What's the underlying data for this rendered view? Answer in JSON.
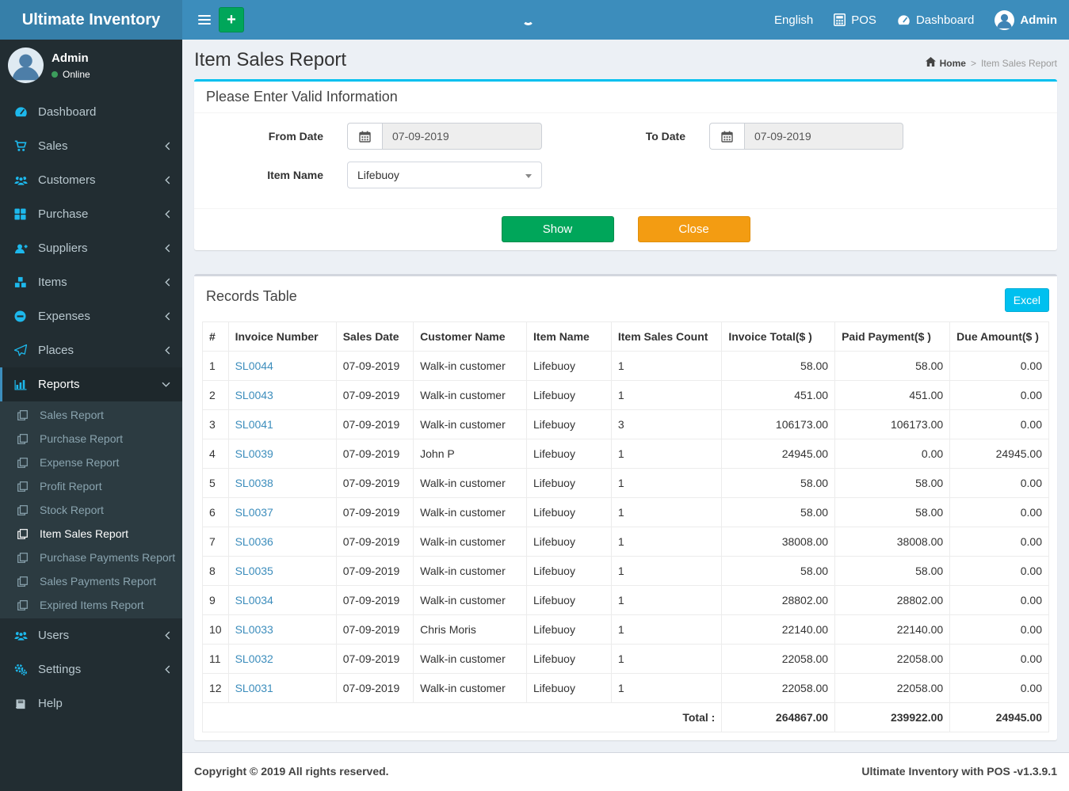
{
  "app": {
    "title": "Ultimate Inventory",
    "version_note": "Ultimate Inventory with POS -v1.3.9.1",
    "copyright": "Copyright © 2019 All rights reserved."
  },
  "navbar": {
    "language": "English",
    "pos": "POS",
    "dashboard": "Dashboard",
    "user": "Admin"
  },
  "sidebar": {
    "user": {
      "name": "Admin",
      "status": "Online"
    },
    "items": [
      {
        "label": "Dashboard"
      },
      {
        "label": "Sales"
      },
      {
        "label": "Customers"
      },
      {
        "label": "Purchase"
      },
      {
        "label": "Suppliers"
      },
      {
        "label": "Items"
      },
      {
        "label": "Expenses"
      },
      {
        "label": "Places"
      },
      {
        "label": "Reports"
      },
      {
        "label": "Users"
      },
      {
        "label": "Settings"
      },
      {
        "label": "Help"
      }
    ],
    "reports_submenu": [
      "Sales Report",
      "Purchase Report",
      "Expense Report",
      "Profit Report",
      "Stock Report",
      "Item Sales Report",
      "Purchase Payments Report",
      "Sales Payments Report",
      "Expired Items Report"
    ],
    "active_item": "Reports",
    "active_submenu": "Item Sales Report"
  },
  "page": {
    "title": "Item Sales Report",
    "breadcrumb": {
      "home": "Home",
      "current": "Item Sales Report"
    }
  },
  "filter_box": {
    "title": "Please Enter Valid Information",
    "from_date_label": "From Date",
    "from_date_value": "07-09-2019",
    "to_date_label": "To Date",
    "to_date_value": "07-09-2019",
    "item_name_label": "Item Name",
    "item_name_value": "Lifebuoy",
    "show_button": "Show",
    "close_button": "Close"
  },
  "records": {
    "title": "Records Table",
    "excel_button": "Excel",
    "columns": [
      "#",
      "Invoice Number",
      "Sales Date",
      "Customer Name",
      "Item Name",
      "Item Sales Count",
      "Invoice Total($ )",
      "Paid Payment($ )",
      "Due Amount($ )"
    ],
    "rows": [
      {
        "num": "1",
        "invoice": "SL0044",
        "date": "07-09-2019",
        "customer": "Walk-in customer",
        "item": "Lifebuoy",
        "count": "1",
        "total": "58.00",
        "paid": "58.00",
        "due": "0.00"
      },
      {
        "num": "2",
        "invoice": "SL0043",
        "date": "07-09-2019",
        "customer": "Walk-in customer",
        "item": "Lifebuoy",
        "count": "1",
        "total": "451.00",
        "paid": "451.00",
        "due": "0.00"
      },
      {
        "num": "3",
        "invoice": "SL0041",
        "date": "07-09-2019",
        "customer": "Walk-in customer",
        "item": "Lifebuoy",
        "count": "3",
        "total": "106173.00",
        "paid": "106173.00",
        "due": "0.00"
      },
      {
        "num": "4",
        "invoice": "SL0039",
        "date": "07-09-2019",
        "customer": "John P",
        "item": "Lifebuoy",
        "count": "1",
        "total": "24945.00",
        "paid": "0.00",
        "due": "24945.00"
      },
      {
        "num": "5",
        "invoice": "SL0038",
        "date": "07-09-2019",
        "customer": "Walk-in customer",
        "item": "Lifebuoy",
        "count": "1",
        "total": "58.00",
        "paid": "58.00",
        "due": "0.00"
      },
      {
        "num": "6",
        "invoice": "SL0037",
        "date": "07-09-2019",
        "customer": "Walk-in customer",
        "item": "Lifebuoy",
        "count": "1",
        "total": "58.00",
        "paid": "58.00",
        "due": "0.00"
      },
      {
        "num": "7",
        "invoice": "SL0036",
        "date": "07-09-2019",
        "customer": "Walk-in customer",
        "item": "Lifebuoy",
        "count": "1",
        "total": "38008.00",
        "paid": "38008.00",
        "due": "0.00"
      },
      {
        "num": "8",
        "invoice": "SL0035",
        "date": "07-09-2019",
        "customer": "Walk-in customer",
        "item": "Lifebuoy",
        "count": "1",
        "total": "58.00",
        "paid": "58.00",
        "due": "0.00"
      },
      {
        "num": "9",
        "invoice": "SL0034",
        "date": "07-09-2019",
        "customer": "Walk-in customer",
        "item": "Lifebuoy",
        "count": "1",
        "total": "28802.00",
        "paid": "28802.00",
        "due": "0.00"
      },
      {
        "num": "10",
        "invoice": "SL0033",
        "date": "07-09-2019",
        "customer": "Chris Moris",
        "item": "Lifebuoy",
        "count": "1",
        "total": "22140.00",
        "paid": "22140.00",
        "due": "0.00"
      },
      {
        "num": "11",
        "invoice": "SL0032",
        "date": "07-09-2019",
        "customer": "Walk-in customer",
        "item": "Lifebuoy",
        "count": "1",
        "total": "22058.00",
        "paid": "22058.00",
        "due": "0.00"
      },
      {
        "num": "12",
        "invoice": "SL0031",
        "date": "07-09-2019",
        "customer": "Walk-in customer",
        "item": "Lifebuoy",
        "count": "1",
        "total": "22058.00",
        "paid": "22058.00",
        "due": "0.00"
      }
    ],
    "total_label": "Total :",
    "totals": {
      "invoice_total": "264867.00",
      "paid_payment": "239922.00",
      "due_amount": "24945.00"
    }
  },
  "colors": {
    "navbar": "#3c8dbc",
    "logo_bg": "#367fa9",
    "sidebar": "#222d32",
    "accent_cyan": "#00c0ef",
    "green": "#00a65a",
    "orange": "#f39c12",
    "icon_blue": "#1db8ec"
  }
}
